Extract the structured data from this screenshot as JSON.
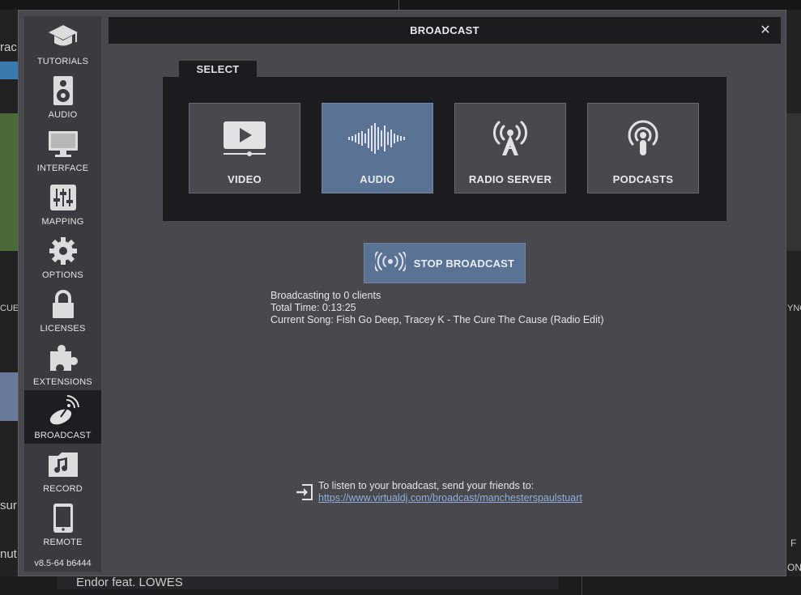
{
  "background": {
    "left_fragments": [
      "rac",
      "CUE",
      "sur",
      "nut"
    ],
    "right_fragments": [
      "YNC",
      "F",
      "ON"
    ],
    "bottom_text": "Endor feat. LOWES"
  },
  "window": {
    "title": "BROADCAST",
    "close_label": "✕"
  },
  "sidebar": {
    "items": [
      {
        "label": "TUTORIALS",
        "icon": "graduation-cap-icon"
      },
      {
        "label": "AUDIO",
        "icon": "speaker-icon"
      },
      {
        "label": "INTERFACE",
        "icon": "monitor-icon"
      },
      {
        "label": "MAPPING",
        "icon": "sliders-icon"
      },
      {
        "label": "OPTIONS",
        "icon": "gear-icon"
      },
      {
        "label": "LICENSES",
        "icon": "lock-icon"
      },
      {
        "label": "EXTENSIONS",
        "icon": "puzzle-icon"
      },
      {
        "label": "BROADCAST",
        "icon": "satellite-dish-icon",
        "active": true
      },
      {
        "label": "RECORD",
        "icon": "music-folder-icon"
      },
      {
        "label": "REMOTE",
        "icon": "tablet-icon"
      }
    ],
    "version": "v8.5-64 b6444"
  },
  "select": {
    "tab_label": "SELECT",
    "tiles": [
      {
        "label": "VIDEO",
        "icon": "video-play-icon"
      },
      {
        "label": "AUDIO",
        "icon": "waveform-icon",
        "active": true
      },
      {
        "label": "RADIO SERVER",
        "icon": "radio-tower-icon"
      },
      {
        "label": "PODCASTS",
        "icon": "podcast-icon"
      }
    ]
  },
  "broadcast": {
    "stop_label": "STOP BROADCAST",
    "status_clients": "Broadcasting to 0 clients",
    "status_time": "Total Time: 0:13:25",
    "status_song": "Current Song: Fish Go Deep, Tracey K - The Cure The Cause (Radio Edit)"
  },
  "share": {
    "text": "To listen to your broadcast, send your friends to:",
    "url": "https://www.virtualdj.com/broadcast/manchesterspaulstuart"
  },
  "colors": {
    "accent": "#5a7395",
    "panel": "#48484d",
    "dark": "#1c1c1e",
    "link": "#8db0dc"
  }
}
